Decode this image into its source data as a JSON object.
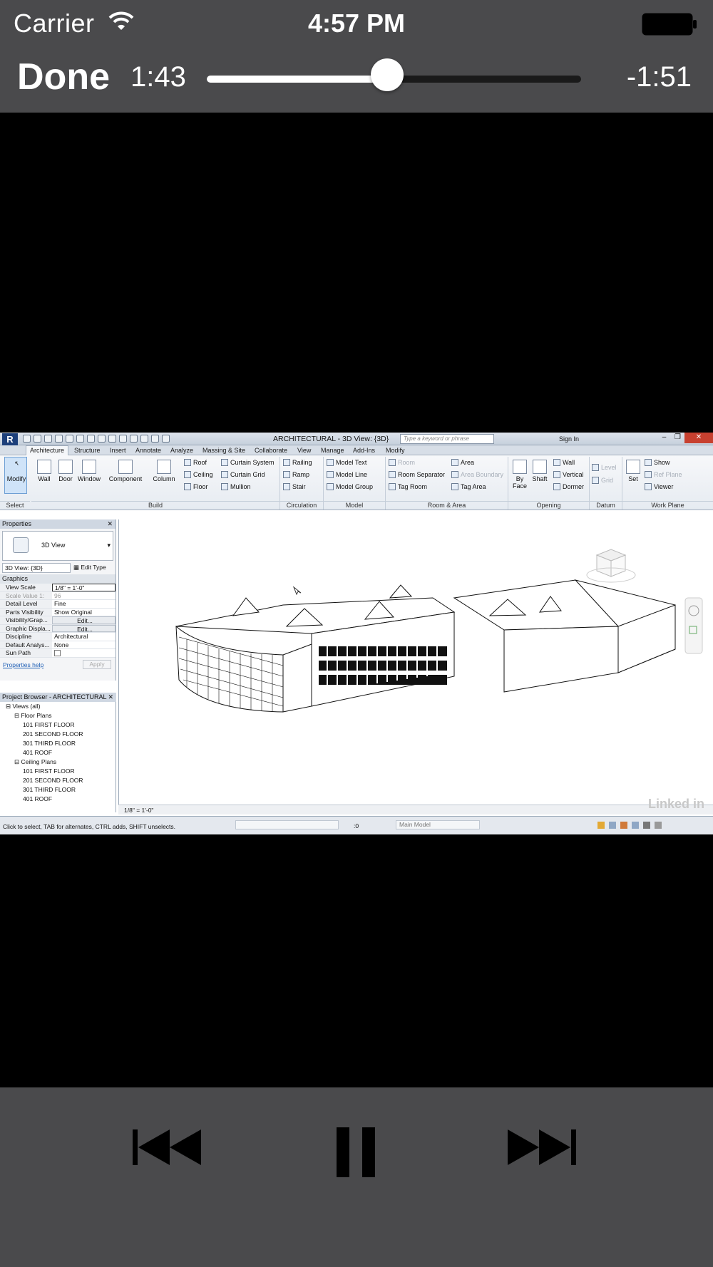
{
  "status_bar": {
    "carrier": "Carrier",
    "time": "4:57 PM"
  },
  "player": {
    "done_label": "Done",
    "elapsed": "1:43",
    "remaining": "-1:51",
    "progress_fraction": 0.4815
  },
  "revit": {
    "window_title": "ARCHITECTURAL - 3D View: {3D}",
    "search_placeholder": "Type a keyword or phrase",
    "sign_in": "Sign In",
    "tabs": [
      "Architecture",
      "Structure",
      "Insert",
      "Annotate",
      "Analyze",
      "Massing & Site",
      "Collaborate",
      "View",
      "Manage",
      "Add-Ins",
      "Modify"
    ],
    "ribbon": {
      "modify": "Modify",
      "wall": "Wall",
      "door": "Door",
      "window": "Window",
      "component": "Component",
      "column": "Column",
      "roof": "Roof",
      "ceiling": "Ceiling",
      "floor": "Floor",
      "curtain_system": "Curtain System",
      "curtain_grid": "Curtain Grid",
      "mullion": "Mullion",
      "railing": "Railing",
      "ramp": "Ramp",
      "stair": "Stair",
      "model_text": "Model Text",
      "model_line": "Model Line",
      "model_group": "Model Group",
      "room": "Room",
      "room_separator": "Room Separator",
      "tag_room": "Tag Room",
      "area": "Area",
      "area_boundary": "Area Boundary",
      "tag_area": "Tag Area",
      "by_face_1": "By",
      "by_face_2": "Face",
      "shaft": "Shaft",
      "wall_open": "Wall",
      "vertical": "Vertical",
      "dormer": "Dormer",
      "level": "Level",
      "grid": "Grid",
      "set": "Set",
      "show": "Show",
      "ref_plane": "Ref Plane",
      "viewer": "Viewer",
      "panels": {
        "select": "Select",
        "build": "Build",
        "circulation": "Circulation",
        "model": "Model",
        "room_area": "Room & Area",
        "opening": "Opening",
        "datum": "Datum",
        "work_plane": "Work Plane"
      }
    },
    "properties": {
      "title": "Properties",
      "type_name": "3D View",
      "instance_selector": "3D View: {3D}",
      "edit_type": "Edit Type",
      "group": "Graphics",
      "rows": [
        {
          "k": "View Scale",
          "v": "1/8\" = 1'-0\""
        },
        {
          "k": "Scale Value    1:",
          "v": "96"
        },
        {
          "k": "Detail Level",
          "v": "Fine"
        },
        {
          "k": "Parts Visibility",
          "v": "Show Original"
        },
        {
          "k": "Visibility/Grap...",
          "v": "Edit..."
        },
        {
          "k": "Graphic Displa...",
          "v": "Edit..."
        },
        {
          "k": "Discipline",
          "v": "Architectural"
        },
        {
          "k": "Default Analys...",
          "v": "None"
        },
        {
          "k": "Sun Path",
          "v": ""
        }
      ],
      "help": "Properties help",
      "apply": "Apply"
    },
    "project_browser": {
      "title": "Project Browser - ARCHITECTURAL",
      "tree": [
        {
          "label": "Views (all)",
          "indent": 1
        },
        {
          "label": "Floor Plans",
          "indent": 2
        },
        {
          "label": "101 FIRST FLOOR",
          "indent": 3
        },
        {
          "label": "201 SECOND FLOOR",
          "indent": 3
        },
        {
          "label": "301 THIRD FLOOR",
          "indent": 3
        },
        {
          "label": "401 ROOF",
          "indent": 3
        },
        {
          "label": "Ceiling Plans",
          "indent": 2
        },
        {
          "label": "101 FIRST FLOOR",
          "indent": 3
        },
        {
          "label": "201 SECOND FLOOR",
          "indent": 3
        },
        {
          "label": "301 THIRD FLOOR",
          "indent": 3
        },
        {
          "label": "401 ROOF",
          "indent": 3
        }
      ]
    },
    "view_scale_bar": "1/8\" = 1'-0\"",
    "status_message": "Click to select, TAB for alternates, CTRL adds, SHIFT unselects.",
    "workset_zero": ":0",
    "main_model": "Main Model",
    "watermark": "Linked in"
  },
  "colors": {
    "bar": "#4a4a4c",
    "video_bg": "#000000",
    "revit_close": "#c7402f"
  }
}
